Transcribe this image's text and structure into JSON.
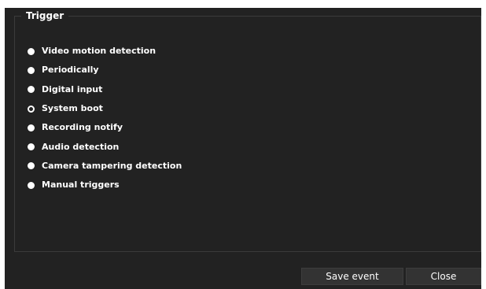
{
  "trigger": {
    "legend": "Trigger",
    "selected_index": 3,
    "options": [
      {
        "label": "Video motion detection"
      },
      {
        "label": "Periodically"
      },
      {
        "label": "Digital input"
      },
      {
        "label": "System boot"
      },
      {
        "label": "Recording notify"
      },
      {
        "label": "Audio detection"
      },
      {
        "label": "Camera tampering detection"
      },
      {
        "label": "Manual triggers"
      }
    ]
  },
  "buttons": {
    "save_label": "Save event",
    "close_label": "Close"
  },
  "colors": {
    "background": "#222222",
    "border": "#3b3b3b",
    "button_bg": "#333333",
    "text": "#ffffff"
  }
}
